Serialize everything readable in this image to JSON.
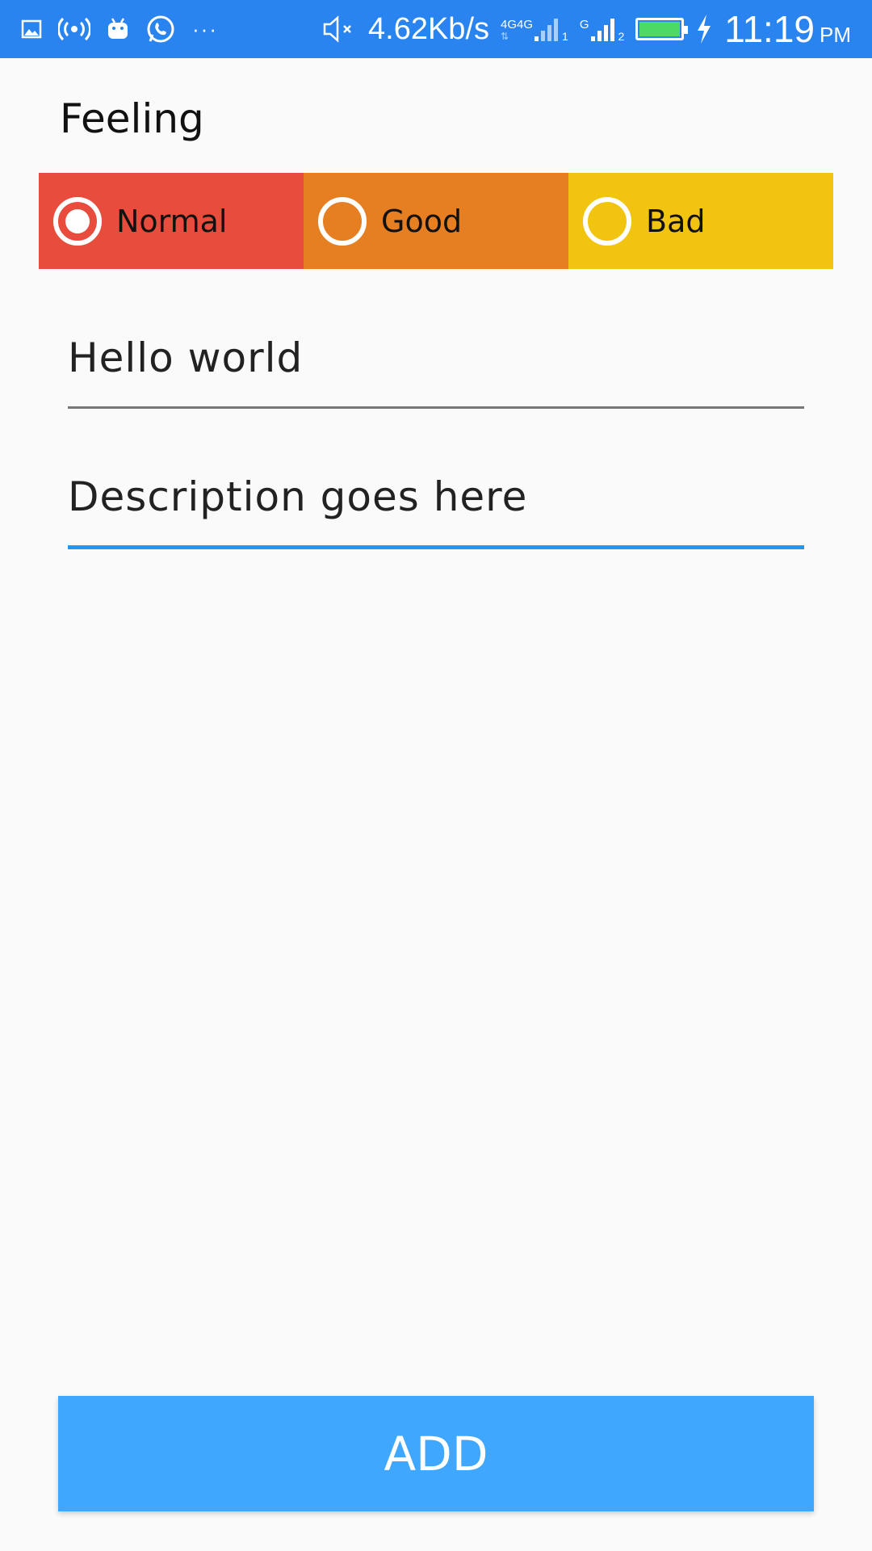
{
  "status_bar": {
    "speed": "4.62Kb/s",
    "net_type_1": "4G",
    "net_type_2": "4G",
    "sim1": "1",
    "net_g": "G",
    "sim2": "2",
    "time": "11:19",
    "ampm": "PM",
    "dots": "···",
    "icons": [
      "gallery-icon",
      "hotspot-icon",
      "android-icon",
      "whatsapp-icon",
      "more-icon",
      "mute-icon",
      "signal-icon",
      "battery-icon",
      "charging-icon"
    ],
    "battery_level": 1.0,
    "background_color": "#2a84f0"
  },
  "form": {
    "feeling_label": "Feeling",
    "feelings": [
      {
        "label": "Normal",
        "color": "#e84c3d",
        "selected": true
      },
      {
        "label": "Good",
        "color": "#e67e22",
        "selected": false
      },
      {
        "label": "Bad",
        "color": "#f1c40f",
        "selected": false
      }
    ],
    "title_value": "Hello world",
    "description_placeholder": "Description goes here",
    "description_underline_color": "#2196f3",
    "add_button_label": "ADD",
    "add_button_color": "#40a7ff"
  }
}
